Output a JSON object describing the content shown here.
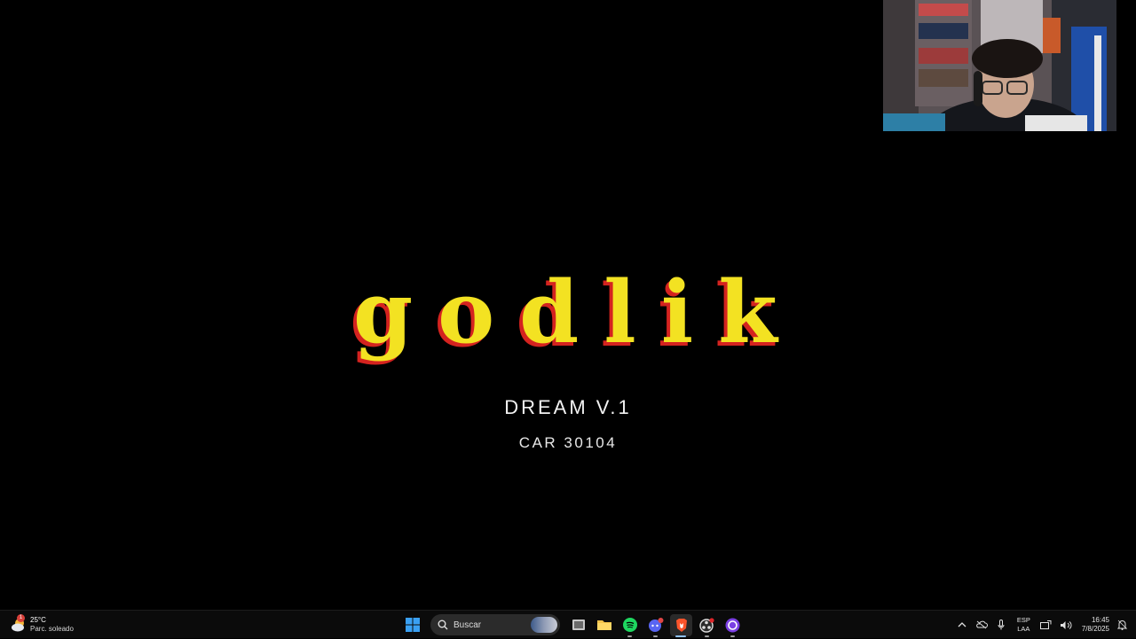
{
  "slide": {
    "logo_text": "godlike",
    "subtitle": "DREAM V.1",
    "code": "CAR 30104"
  },
  "taskbar": {
    "weather": {
      "temperature": "25°C",
      "description": "Parc. soleado",
      "badge": "1"
    },
    "search": {
      "placeholder": "Buscar"
    },
    "apps": [
      {
        "name": "task-view",
        "icon": "task-view-icon"
      },
      {
        "name": "file-explorer",
        "icon": "folder-icon"
      },
      {
        "name": "spotify",
        "icon": "spotify-icon"
      },
      {
        "name": "discord",
        "icon": "discord-icon"
      },
      {
        "name": "brave",
        "icon": "brave-icon"
      },
      {
        "name": "obs",
        "icon": "obs-icon"
      },
      {
        "name": "app-circle",
        "icon": "circle-app-icon"
      }
    ],
    "tray": {
      "language_top": "ESP",
      "language_bottom": "LAA",
      "time": "16:45",
      "date": "7/8/2025"
    }
  },
  "colors": {
    "logo_fill": "#f3e222",
    "logo_shadow": "#d4231f",
    "accent": "#8fc3ff"
  }
}
